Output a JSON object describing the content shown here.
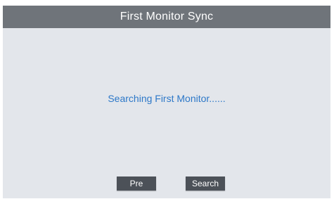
{
  "header": {
    "title": "First Monitor Sync"
  },
  "main": {
    "status": "Searching First Monitor......"
  },
  "buttons": {
    "pre_label": "Pre",
    "search_label": "Search"
  },
  "colors": {
    "title_bar": "#6f747a",
    "background": "#e3e6eb",
    "status_text": "#2d78c8",
    "button": "#4c5158"
  }
}
